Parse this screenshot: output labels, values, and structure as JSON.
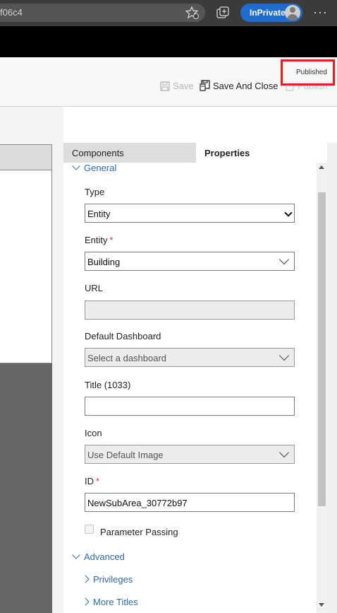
{
  "browser": {
    "url_fragment": "f06c4",
    "inprivate_label": "InPrivate",
    "icons": [
      "favorites-star-icon",
      "collections-icon",
      "more-menu-icon"
    ]
  },
  "command_bar": {
    "save_label": "Save",
    "save_and_close_label": "Save And Close",
    "publish_label": "Publish",
    "published_status": "Published"
  },
  "tabs": {
    "components": "Components",
    "properties": "Properties"
  },
  "properties": {
    "general_header": "General",
    "type": {
      "label": "Type",
      "value": "Entity"
    },
    "entity": {
      "label": "Entity",
      "required_mark": "*",
      "value": "Building"
    },
    "url": {
      "label": "URL",
      "value": ""
    },
    "default_dashboard": {
      "label": "Default Dashboard",
      "value": "Select a dashboard"
    },
    "title": {
      "label": "Title (1033)",
      "value": ""
    },
    "icon": {
      "label": "Icon",
      "value": "Use Default Image"
    },
    "id": {
      "label": "ID",
      "required_mark": "*",
      "value": "NewSubArea_30772b97"
    },
    "parameter_passing": {
      "label": "Parameter Passing",
      "checked": false
    },
    "advanced_header": "Advanced",
    "privileges_link": "Privileges",
    "more_titles_link": "More Titles"
  },
  "colors": {
    "accent": "#2b6ab5",
    "required": "#d13438",
    "published_highlight": "#e02020",
    "inprivate_badge": "#1f6ccf"
  }
}
